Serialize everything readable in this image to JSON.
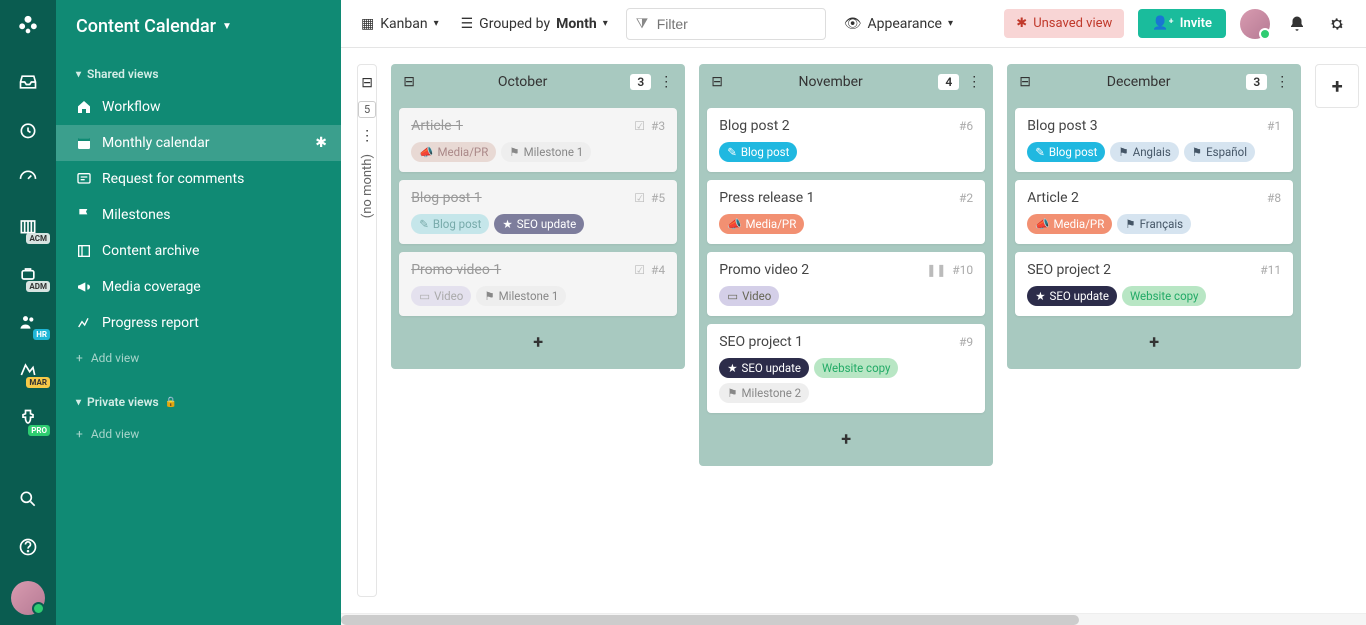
{
  "header": {
    "title": "Content Calendar"
  },
  "sidebar": {
    "shared_label": "Shared views",
    "private_label": "Private views",
    "add_view": "Add view",
    "items": [
      {
        "icon": "home",
        "label": "Workflow"
      },
      {
        "icon": "calendar",
        "label": "Monthly calendar",
        "active": true,
        "starred": true
      },
      {
        "icon": "comments",
        "label": "Request for comments"
      },
      {
        "icon": "flag",
        "label": "Milestones"
      },
      {
        "icon": "archive",
        "label": "Content archive"
      },
      {
        "icon": "bullhorn",
        "label": "Media coverage"
      },
      {
        "icon": "chart",
        "label": "Progress report"
      }
    ]
  },
  "topbar": {
    "view_type": "Kanban",
    "grouped_by_label": "Grouped by",
    "grouped_by_value": "Month",
    "filter_placeholder": "Filter",
    "appearance": "Appearance",
    "unsaved": "Unsaved view",
    "invite": "Invite"
  },
  "board": {
    "no_month": {
      "label": "(no month)",
      "count": "5"
    },
    "columns": [
      {
        "title": "October",
        "count": "3",
        "cards": [
          {
            "title": "Article 1",
            "id": "#3",
            "done": true,
            "check": true,
            "tags": [
              {
                "cls": "media muted",
                "icon": "📣",
                "text": "Media/PR"
              },
              {
                "cls": "milestone",
                "icon": "⚑",
                "text": "Milestone 1"
              }
            ]
          },
          {
            "title": "Blog post 1",
            "id": "#5",
            "done": true,
            "check": true,
            "tags": [
              {
                "cls": "blogpost muted",
                "icon": "✎",
                "text": "Blog post"
              },
              {
                "cls": "seo",
                "icon": "★",
                "text": "SEO update"
              }
            ]
          },
          {
            "title": "Promo video 1",
            "id": "#4",
            "done": true,
            "check": true,
            "tags": [
              {
                "cls": "video muted",
                "icon": "▭",
                "text": "Video"
              },
              {
                "cls": "milestone",
                "icon": "⚑",
                "text": "Milestone 1"
              }
            ]
          }
        ]
      },
      {
        "title": "November",
        "count": "4",
        "cards": [
          {
            "title": "Blog post 2",
            "id": "#6",
            "tags": [
              {
                "cls": "blogpost bright",
                "icon": "✎",
                "text": "Blog post"
              }
            ]
          },
          {
            "title": "Press release 1",
            "id": "#2",
            "tags": [
              {
                "cls": "media",
                "icon": "📣",
                "text": "Media/PR"
              }
            ]
          },
          {
            "title": "Promo video 2",
            "id": "#10",
            "pause": true,
            "tags": [
              {
                "cls": "video",
                "icon": "▭",
                "text": "Video"
              }
            ]
          },
          {
            "title": "SEO project 1",
            "id": "#9",
            "tags": [
              {
                "cls": "seo dark",
                "icon": "★",
                "text": "SEO update"
              },
              {
                "cls": "website",
                "text": "Website copy"
              },
              {
                "cls": "milestone",
                "icon": "⚑",
                "text": "Milestone 2"
              }
            ]
          }
        ]
      },
      {
        "title": "December",
        "count": "3",
        "cards": [
          {
            "title": "Blog post 3",
            "id": "#1",
            "tags": [
              {
                "cls": "blogpost bright",
                "icon": "✎",
                "text": "Blog post"
              },
              {
                "cls": "lang",
                "icon": "⚑",
                "text": "Anglais"
              },
              {
                "cls": "lang",
                "icon": "⚑",
                "text": "Español"
              }
            ]
          },
          {
            "title": "Article 2",
            "id": "#8",
            "tags": [
              {
                "cls": "media",
                "icon": "📣",
                "text": "Media/PR"
              },
              {
                "cls": "lang",
                "icon": "⚑",
                "text": "Français"
              }
            ]
          },
          {
            "title": "SEO project 2",
            "id": "#11",
            "tags": [
              {
                "cls": "seo dark",
                "icon": "★",
                "text": "SEO update"
              },
              {
                "cls": "website",
                "text": "Website copy"
              }
            ]
          }
        ]
      }
    ]
  },
  "rail_badges": {
    "acm": "ACM",
    "adm": "ADM",
    "hr": "HR",
    "mar": "MAR",
    "pro": "PRO"
  }
}
